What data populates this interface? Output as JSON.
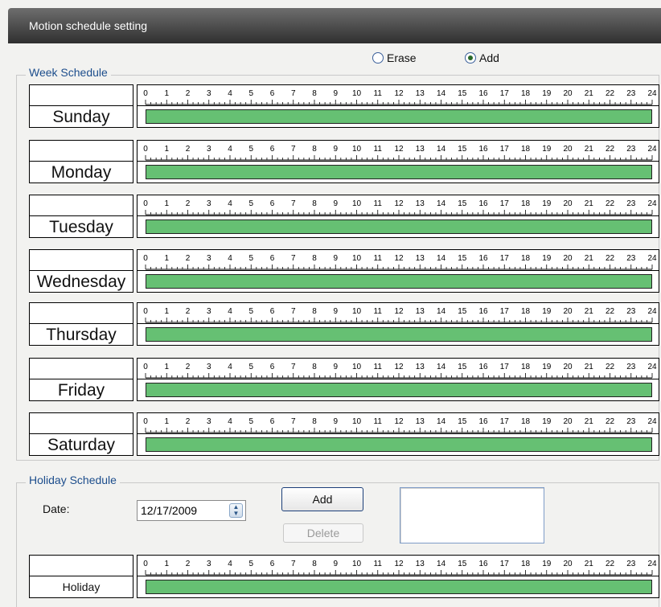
{
  "window": {
    "title": "Motion schedule setting"
  },
  "mode": {
    "options": [
      {
        "label": "Erase",
        "selected": false
      },
      {
        "label": "Add",
        "selected": true
      }
    ]
  },
  "week_schedule": {
    "title": "Week Schedule",
    "hours": [
      "0",
      "1",
      "2",
      "3",
      "4",
      "5",
      "6",
      "7",
      "8",
      "9",
      "10",
      "11",
      "12",
      "13",
      "14",
      "15",
      "16",
      "17",
      "18",
      "19",
      "20",
      "21",
      "22",
      "23",
      "24"
    ],
    "days": [
      {
        "name": "Sunday",
        "start": 0,
        "end": 24
      },
      {
        "name": "Monday",
        "start": 0,
        "end": 24
      },
      {
        "name": "Tuesday",
        "start": 0,
        "end": 24
      },
      {
        "name": "Wednesday",
        "start": 0,
        "end": 24
      },
      {
        "name": "Thursday",
        "start": 0,
        "end": 24
      },
      {
        "name": "Friday",
        "start": 0,
        "end": 24
      },
      {
        "name": "Saturday",
        "start": 0,
        "end": 24
      }
    ],
    "bar_color": "#66c073"
  },
  "holiday_schedule": {
    "title": "Holiday Schedule",
    "date_label": "Date:",
    "date_value": "12/17/2009",
    "add_label": "Add",
    "delete_label": "Delete",
    "row": {
      "name": "Holiday",
      "start": 0,
      "end": 24
    }
  },
  "icons": {
    "spinner": "up-down-spin-icon"
  }
}
